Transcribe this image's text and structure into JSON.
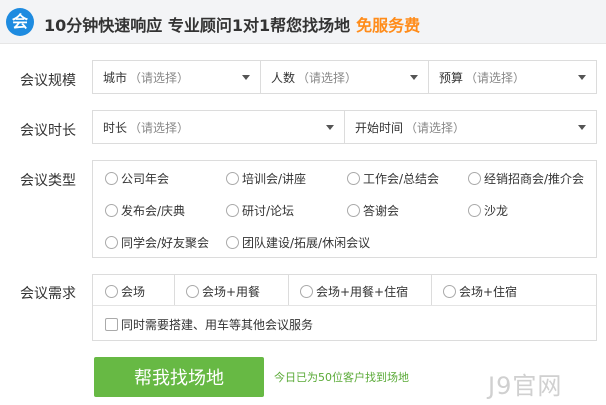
{
  "header": {
    "logo_char": "会",
    "title": "10分钟快速响应 专业顾问1对1帮您找场地",
    "free": "免服务费"
  },
  "hint": "（请选择）",
  "rows": {
    "scale": {
      "label": "会议规模",
      "selects": [
        "城市",
        "人数",
        "预算"
      ]
    },
    "duration": {
      "label": "会议时长",
      "selects": [
        "时长",
        "开始时间"
      ]
    },
    "type": {
      "label": "会议类型",
      "options": [
        "公司年会",
        "培训会/讲座",
        "工作会/总结会",
        "经销招商会/推介会",
        "发布会/庆典",
        "研讨/论坛",
        "答谢会",
        "沙龙",
        "同学会/好友聚会",
        "团队建设/拓展/休闲会议"
      ]
    },
    "needs": {
      "label": "会议需求",
      "options": [
        "会场",
        "会场+用餐",
        "会场+用餐+住宿",
        "会场+住宿"
      ],
      "extra": "同时需要搭建、用车等其他会议服务"
    }
  },
  "submit_label": "帮我找场地",
  "today_text": "今日已为50位客户找到场地",
  "watermark": "J9官网"
}
